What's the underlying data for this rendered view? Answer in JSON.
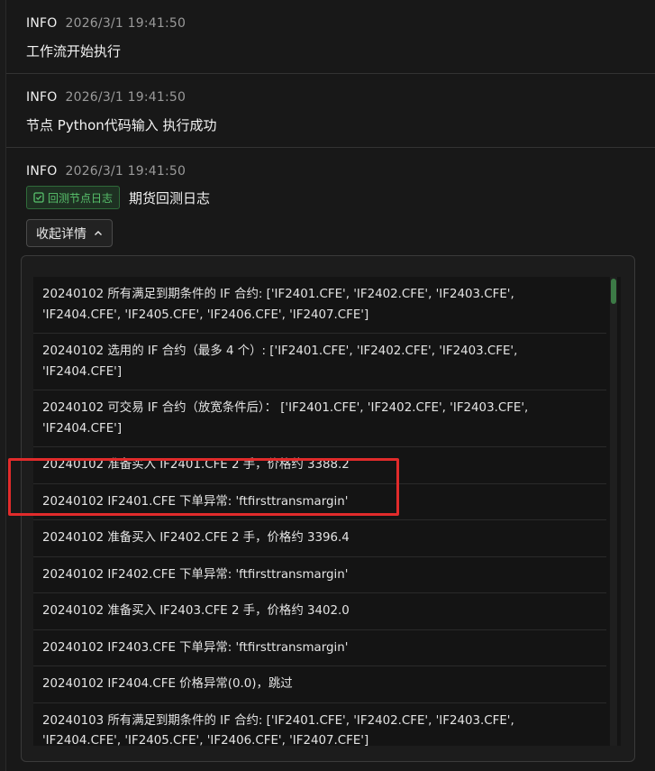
{
  "entries": [
    {
      "level": "INFO",
      "time": "2026/3/1 19:41:50",
      "message": "工作流开始执行"
    },
    {
      "level": "INFO",
      "time": "2026/3/1 19:41:50",
      "message": "节点 Python代码输入 执行成功"
    },
    {
      "level": "INFO",
      "time": "2026/3/1 19:41:50",
      "badge": "回测节点日志",
      "message": "期货回测日志"
    }
  ],
  "collapse_label": "收起详情",
  "log_lines": [
    "20240102 所有满足到期条件的 IF 合约: ['IF2401.CFE', 'IF2402.CFE', 'IF2403.CFE', 'IF2404.CFE', 'IF2405.CFE', 'IF2406.CFE', 'IF2407.CFE']",
    "20240102 选用的 IF 合约（最多 4 个）: ['IF2401.CFE', 'IF2402.CFE', 'IF2403.CFE', 'IF2404.CFE']",
    "20240102 可交易 IF 合约（放宽条件后）： ['IF2401.CFE', 'IF2402.CFE', 'IF2403.CFE', 'IF2404.CFE']",
    "20240102 准备买入 IF2401.CFE 2 手，价格约 3388.2",
    "20240102 IF2401.CFE 下单异常: 'ftfirsttransmargin'",
    "20240102 准备买入 IF2402.CFE 2 手，价格约 3396.4",
    "20240102 IF2402.CFE 下单异常: 'ftfirsttransmargin'",
    "20240102 准备买入 IF2403.CFE 2 手，价格约 3402.0",
    "20240102 IF2403.CFE 下单异常: 'ftfirsttransmargin'",
    "20240102 IF2404.CFE 价格异常(0.0)，跳过",
    "20240103 所有满足到期条件的 IF 合约: ['IF2401.CFE', 'IF2402.CFE', 'IF2403.CFE', 'IF2404.CFE', 'IF2405.CFE', 'IF2406.CFE', 'IF2407.CFE']"
  ],
  "colors": {
    "badge_green": "#58c26c",
    "highlight_red": "#e12b2b",
    "scroll_thumb": "#3c7a46"
  }
}
